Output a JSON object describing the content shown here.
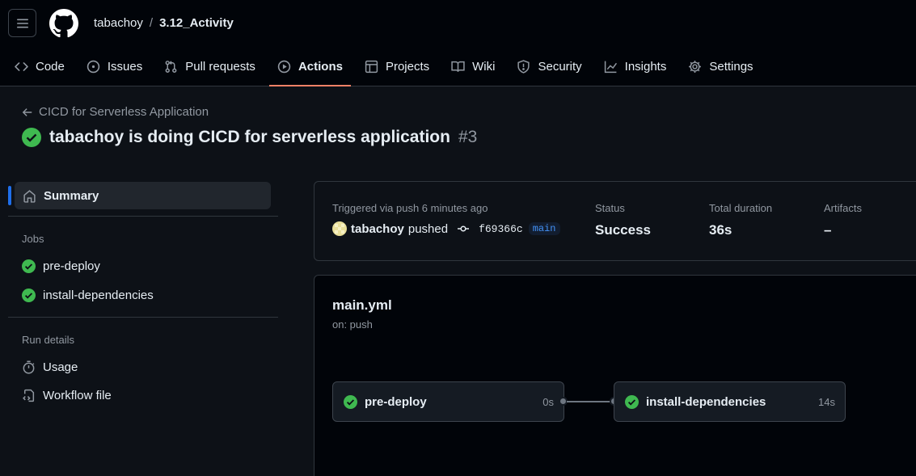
{
  "header": {
    "owner": "tabachoy",
    "separator": "/",
    "repo": "3.12_Activity"
  },
  "tabs": [
    {
      "label": "Code",
      "icon": "code-icon"
    },
    {
      "label": "Issues",
      "icon": "issue-icon"
    },
    {
      "label": "Pull requests",
      "icon": "pull-request-icon"
    },
    {
      "label": "Actions",
      "icon": "play-icon",
      "active": true
    },
    {
      "label": "Projects",
      "icon": "table-icon"
    },
    {
      "label": "Wiki",
      "icon": "book-icon"
    },
    {
      "label": "Security",
      "icon": "shield-icon"
    },
    {
      "label": "Insights",
      "icon": "graph-icon"
    },
    {
      "label": "Settings",
      "icon": "gear-icon"
    }
  ],
  "page": {
    "back_link": "CICD for Serverless Application",
    "run_title": "tabachoy is doing CICD for serverless application",
    "run_number": "#3"
  },
  "sidebar": {
    "summary": "Summary",
    "jobs_heading": "Jobs",
    "jobs": [
      "pre-deploy",
      "install-dependencies"
    ],
    "run_details_heading": "Run details",
    "usage": "Usage",
    "workflow_file": "Workflow file"
  },
  "summary": {
    "triggered": "Triggered via push 6 minutes ago",
    "actor": "tabachoy",
    "action": "pushed",
    "commit": "f69366c",
    "branch": "main",
    "status_label": "Status",
    "status_value": "Success",
    "duration_label": "Total duration",
    "duration_value": "36s",
    "artifacts_label": "Artifacts",
    "artifacts_value": "–"
  },
  "workflow": {
    "file": "main.yml",
    "trigger": "on: push",
    "jobs": [
      {
        "name": "pre-deploy",
        "duration": "0s"
      },
      {
        "name": "install-dependencies",
        "duration": "14s"
      }
    ]
  },
  "colors": {
    "success": "#3fb950",
    "accent_underline": "#f78166",
    "link": "#4493f8"
  }
}
